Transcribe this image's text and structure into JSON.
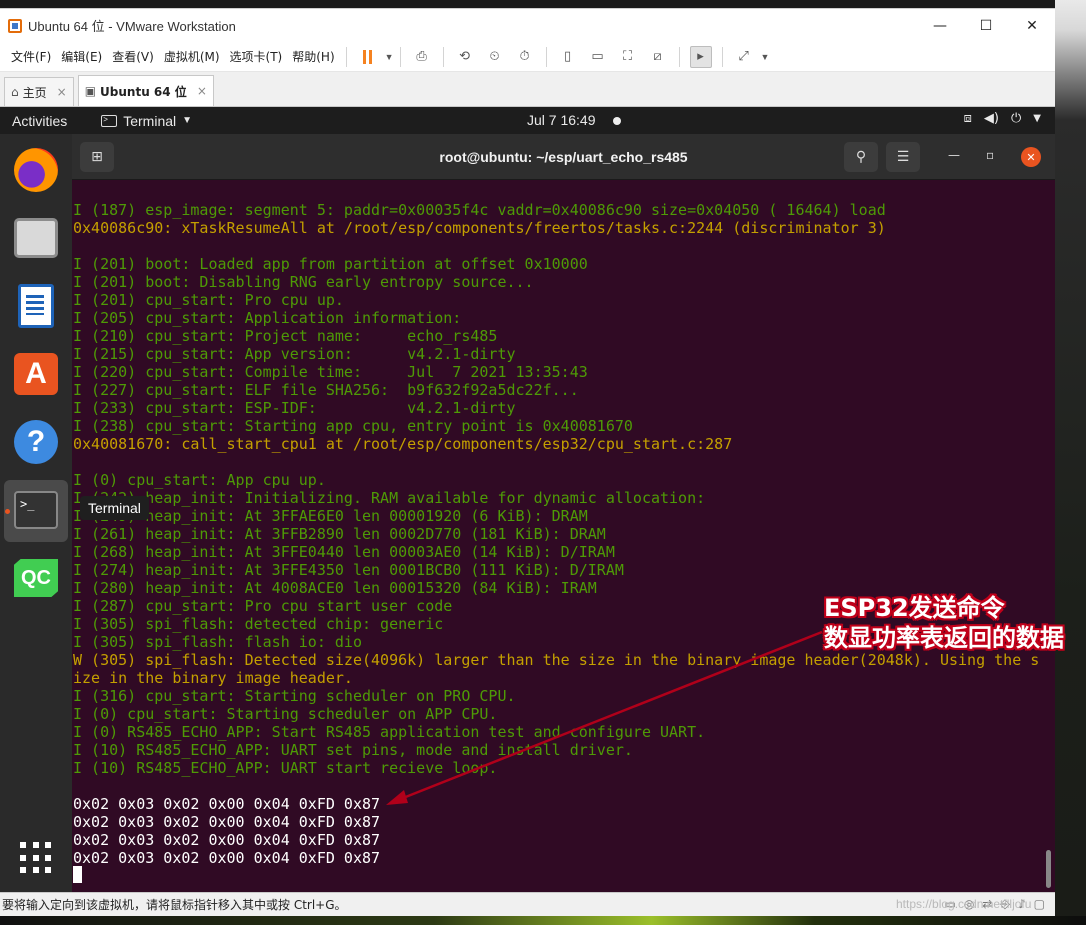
{
  "vmware": {
    "window_title": "Ubuntu 64 位 - VMware Workstation",
    "controls": {
      "minimize": "—",
      "maximize": "☐",
      "close": "✕"
    },
    "menus": [
      "文件(F)",
      "编辑(E)",
      "查看(V)",
      "虚拟机(M)",
      "选项卡(T)",
      "帮助(H)"
    ],
    "tabs": [
      {
        "label": "主页",
        "icon": "home-icon",
        "close": "×"
      },
      {
        "label": "Ubuntu 64 位",
        "icon": "vm-icon",
        "close": "×",
        "active": true
      }
    ],
    "status_text": "要将输入定向到该虚拟机，请将鼠标指针移入其中或按 Ctrl+G。",
    "watermark": "https://blog.csdn.net/lljofu"
  },
  "ubuntu": {
    "topbar": {
      "activities": "Activities",
      "app_name": "Terminal",
      "clock": "Jul 7  16:49"
    },
    "dock": {
      "items": [
        "firefox-icon",
        "files-icon",
        "libreoffice-writer-icon",
        "software-store-icon",
        "help-icon",
        "terminal-icon",
        "qtcreator-icon",
        "show-apps-icon"
      ],
      "tooltip": "Terminal",
      "qc_label": "QC",
      "store_glyph": "A",
      "help_glyph": "?",
      "term_glyph": ">_"
    }
  },
  "terminal": {
    "title": "root@ubuntu: ~/esp/uart_echo_rs485",
    "lines": [
      {
        "t": "I (187) esp_image: segment 5: paddr=0x00035f4c vaddr=0x40086c90 size=0x04050 ( 16464) load",
        "c": "green"
      },
      {
        "t": "0x40086c90: xTaskResumeAll at /root/esp/components/freertos/tasks.c:2244 (discriminator 3)",
        "c": "yellow"
      },
      {
        "t": "",
        "c": "green"
      },
      {
        "t": "I (201) boot: Loaded app from partition at offset 0x10000",
        "c": "green"
      },
      {
        "t": "I (201) boot: Disabling RNG early entropy source...",
        "c": "green"
      },
      {
        "t": "I (201) cpu_start: Pro cpu up.",
        "c": "green"
      },
      {
        "t": "I (205) cpu_start: Application information:",
        "c": "green"
      },
      {
        "t": "I (210) cpu_start: Project name:     echo_rs485",
        "c": "green"
      },
      {
        "t": "I (215) cpu_start: App version:      v4.2.1-dirty",
        "c": "green"
      },
      {
        "t": "I (220) cpu_start: Compile time:     Jul  7 2021 13:35:43",
        "c": "green"
      },
      {
        "t": "I (227) cpu_start: ELF file SHA256:  b9f632f92a5dc22f...",
        "c": "green"
      },
      {
        "t": "I (233) cpu_start: ESP-IDF:          v4.2.1-dirty",
        "c": "green"
      },
      {
        "t": "I (238) cpu_start: Starting app cpu, entry point is 0x40081670",
        "c": "green"
      },
      {
        "t": "0x40081670: call_start_cpu1 at /root/esp/components/esp32/cpu_start.c:287",
        "c": "yellow"
      },
      {
        "t": "",
        "c": "green"
      },
      {
        "t": "I (0) cpu_start: App cpu up.",
        "c": "green"
      },
      {
        "t": "I (242) heap_init: Initializing. RAM available for dynamic allocation:",
        "c": "green"
      },
      {
        "t": "I (249) heap_init: At 3FFAE6E0 len 00001920 (6 KiB): DRAM",
        "c": "green"
      },
      {
        "t": "I (261) heap_init: At 3FFB2890 len 0002D770 (181 KiB): DRAM",
        "c": "green"
      },
      {
        "t": "I (268) heap_init: At 3FFE0440 len 00003AE0 (14 KiB): D/IRAM",
        "c": "green"
      },
      {
        "t": "I (274) heap_init: At 3FFE4350 len 0001BCB0 (111 KiB): D/IRAM",
        "c": "green"
      },
      {
        "t": "I (280) heap_init: At 4008ACE0 len 00015320 (84 KiB): IRAM",
        "c": "green"
      },
      {
        "t": "I (287) cpu_start: Pro cpu start user code",
        "c": "green"
      },
      {
        "t": "I (305) spi_flash: detected chip: generic",
        "c": "green"
      },
      {
        "t": "I (305) spi_flash: flash io: dio",
        "c": "green"
      },
      {
        "t": "W (305) spi_flash: Detected size(4096k) larger than the size in the binary image header(2048k). Using the s",
        "c": "yellow"
      },
      {
        "t": "ize in the binary image header.",
        "c": "yellow"
      },
      {
        "t": "I (316) cpu_start: Starting scheduler on PRO CPU.",
        "c": "green"
      },
      {
        "t": "I (0) cpu_start: Starting scheduler on APP CPU.",
        "c": "green"
      },
      {
        "t": "I (0) RS485_ECHO_APP: Start RS485 application test and configure UART.",
        "c": "green"
      },
      {
        "t": "I (10) RS485_ECHO_APP: UART set pins, mode and install driver.",
        "c": "green"
      },
      {
        "t": "I (10) RS485_ECHO_APP: UART start recieve loop.",
        "c": "green"
      },
      {
        "t": "",
        "c": "white"
      },
      {
        "t": "0x02 0x03 0x02 0x00 0x04 0xFD 0x87",
        "c": "white"
      },
      {
        "t": "0x02 0x03 0x02 0x00 0x04 0xFD 0x87",
        "c": "white"
      },
      {
        "t": "0x02 0x03 0x02 0x00 0x04 0xFD 0x87",
        "c": "white"
      },
      {
        "t": "0x02 0x03 0x02 0x00 0x04 0xFD 0x87",
        "c": "white"
      }
    ]
  },
  "annotation": {
    "line1": "ESP32发送命令",
    "line2": "数显功率表返回的数据",
    "color": "#c0001a"
  },
  "colors": {
    "terminal_bg": "#300a24",
    "ok_green": "#4e9a06",
    "warn_yellow": "#c4a000",
    "ubuntu_orange": "#e95420",
    "vmware_pause": "#f58220"
  }
}
